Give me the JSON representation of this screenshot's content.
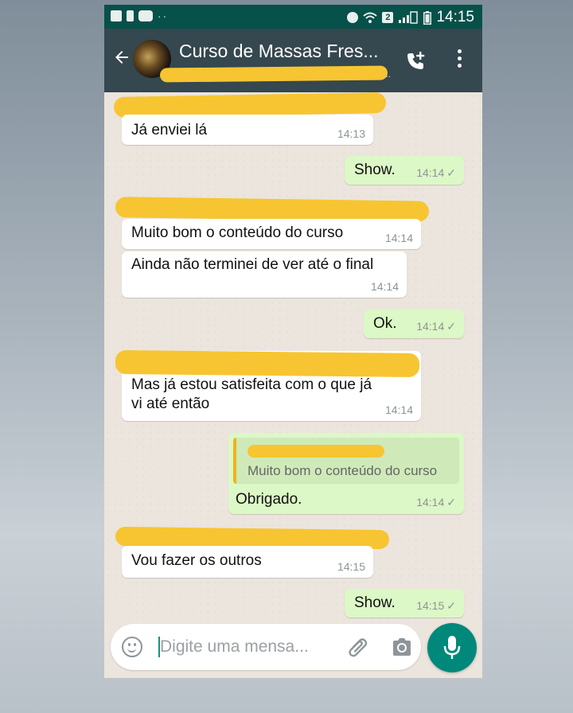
{
  "status_bar": {
    "time": "14:15",
    "sim_slot": "2"
  },
  "header": {
    "title": "Curso de Massas Fres...",
    "subtitle_more": "...",
    "back_icon": "arrow-left-icon",
    "call_icon": "add-call-icon",
    "menu_icon": "more-vert-icon"
  },
  "messages": [
    {
      "direction": "in",
      "text": "Já enviei lá",
      "time": "14:13",
      "sender_redacted": true
    },
    {
      "direction": "out",
      "text": "Show.",
      "time": "14:14",
      "status": "✓"
    },
    {
      "direction": "in",
      "text": "Muito bom o conteúdo do curso",
      "time": "14:14",
      "sender_redacted": true
    },
    {
      "direction": "in",
      "text": "Ainda não terminei de ver até o final",
      "time": "14:14"
    },
    {
      "direction": "out",
      "text": "Ok.",
      "time": "14:14",
      "status": "✓"
    },
    {
      "direction": "in",
      "text_line1": "Mas já estou satisfeita com o que já",
      "text_line2": "vi até então",
      "time": "14:14",
      "sender_redacted": true
    },
    {
      "direction": "out",
      "quoted_text": "Muito bom o conteúdo do curso",
      "text": "Obrigado.",
      "time": "14:14",
      "status": "✓"
    },
    {
      "direction": "in",
      "text": "Vou fazer os outros",
      "time": "14:15",
      "sender_redacted": true
    },
    {
      "direction": "out",
      "text": "Show.",
      "time": "14:15",
      "status": "✓"
    }
  ],
  "composer": {
    "placeholder": "Digite uma mensa...",
    "emoji_icon": "emoji-icon",
    "attach_icon": "paperclip-icon",
    "camera_icon": "camera-icon",
    "mic_icon": "microphone-icon"
  },
  "colors": {
    "header": "#35474f",
    "status_bar": "#06514a",
    "chat_background": "#ece5dd",
    "outgoing_bubble": "#dcf8c6",
    "incoming_bubble": "#ffffff",
    "redaction": "#f7c531",
    "accent": "#00897b"
  }
}
